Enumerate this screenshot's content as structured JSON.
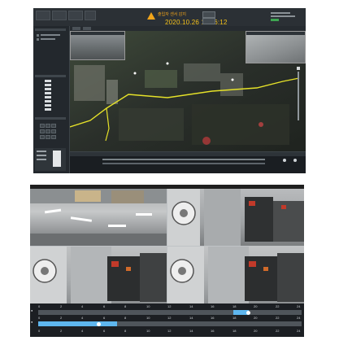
{
  "top": {
    "tabs": [
      "",
      "",
      "",
      ""
    ],
    "alarm_text": "출입자 센서 감지",
    "alarm_time": "2020.10.26 11:56:12"
  },
  "timeline": {
    "row1_ticks": [
      "0",
      "2",
      "4",
      "6",
      "8",
      "10",
      "12",
      "14",
      "16",
      "18",
      "20",
      "22",
      "24"
    ],
    "row2_ticks": [
      "0",
      "2",
      "4",
      "6",
      "8",
      "10",
      "12",
      "14",
      "16",
      "18",
      "20",
      "22",
      "24"
    ],
    "row1_fill": 0.06,
    "row2_fill": 0.3
  },
  "colors": {
    "accent": "#5eb6ee",
    "alarm": "#f2a51a",
    "boundary": "#e6e229"
  }
}
